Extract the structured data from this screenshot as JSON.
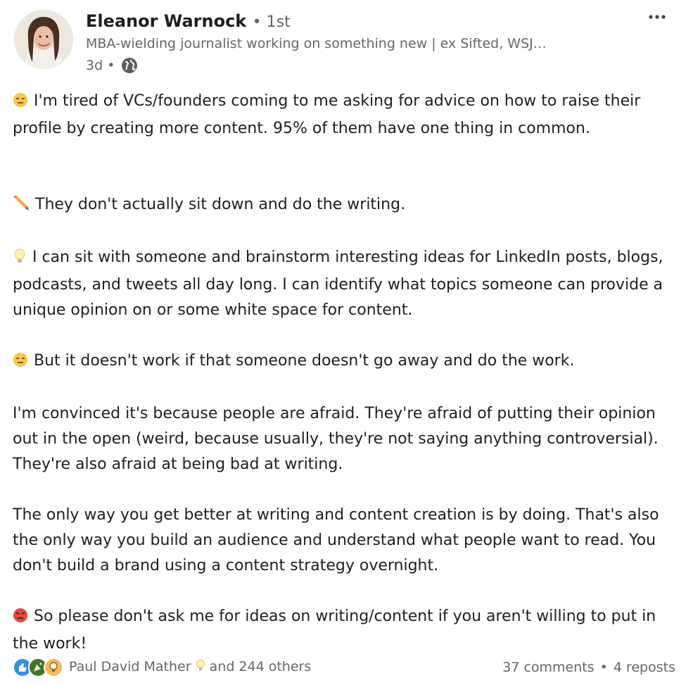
{
  "author": {
    "name": "Eleanor Warnock",
    "degree": "• 1st",
    "headline": "MBA-wielding journalist working on something new | ex Sifted, WSJ…",
    "time": "3d •",
    "visibility_icon": "globe-icon"
  },
  "post": {
    "paragraphs": [
      {
        "emoji": "expressionless-face-icon",
        "text": "I'm tired of VCs/founders coming to me asking for advice on how to raise their profile by creating more content. 95% of them have one thing in common."
      },
      {
        "emoji": "pencil-icon",
        "text": "They don't actually sit down and do the writing."
      },
      {
        "emoji": "lightbulb-icon",
        "text": "I can sit with someone and brainstorm interesting ideas for LinkedIn posts, blogs, podcasts, and tweets all day long. I can identify what topics someone can provide a unique opinion on or some white space for content."
      },
      {
        "emoji": "expressionless-face-icon",
        "text": "But it doesn't work if that someone doesn't go away and do the work."
      },
      {
        "emoji": "",
        "text": "I'm convinced it's because people are afraid. They're afraid of putting their opinion out in the open (weird, because usually, they're not saying anything controversial). They're also afraid at being bad at writing."
      },
      {
        "emoji": "",
        "text": "The only way you get better at writing and content creation is by doing. That's also the only way you build an audience and understand what people want to read. You don't build a brand using a content strategy overnight."
      },
      {
        "emoji": "angry-face-icon",
        "text": "So please don't ask me for ideas on writing/content if you aren't willing to put in the work!"
      }
    ]
  },
  "social": {
    "reactions": [
      "like-icon",
      "celebrate-icon",
      "insightful-icon"
    ],
    "reactors": "Paul David Mather",
    "reactor_badge": "lightbulb-icon",
    "others": "and 244 others",
    "comments": "37 comments",
    "dot": "•",
    "reposts": "4 reposts"
  },
  "colors": {
    "text": "#1f1f1f",
    "muted": "#666666",
    "like": "#378fe9",
    "celebrate": "#44712e",
    "insightful": "#f5bb5c"
  }
}
